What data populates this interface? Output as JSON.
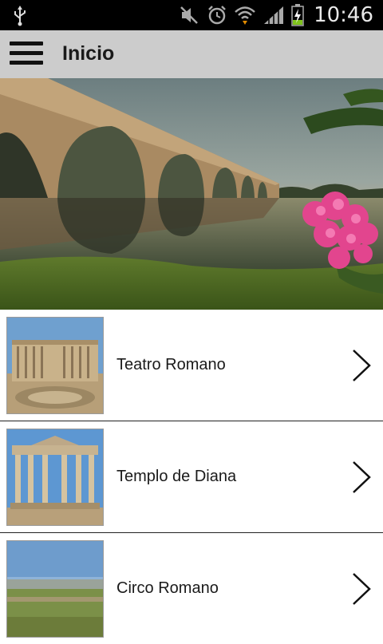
{
  "status_bar": {
    "time": "10:46",
    "icons": [
      "usb-icon",
      "mute-icon",
      "alarm-icon",
      "wifi-icon",
      "signal-icon",
      "battery-charging-icon"
    ]
  },
  "action_bar": {
    "title": "Inicio",
    "menu_icon": "hamburger-menu-icon"
  },
  "hero": {
    "image": "roman-bridge-photo"
  },
  "list": {
    "items": [
      {
        "label": "Teatro Romano",
        "thumbnail": "roman-theatre-photo"
      },
      {
        "label": "Templo de Diana",
        "thumbnail": "diana-temple-photo"
      },
      {
        "label": "Circo Romano",
        "thumbnail": "roman-circus-photo"
      }
    ],
    "chevron_icon": "chevron-right-icon"
  },
  "colors": {
    "status_bar_bg": "#000000",
    "action_bar_bg": "#cccccc",
    "list_divider": "#222222"
  }
}
